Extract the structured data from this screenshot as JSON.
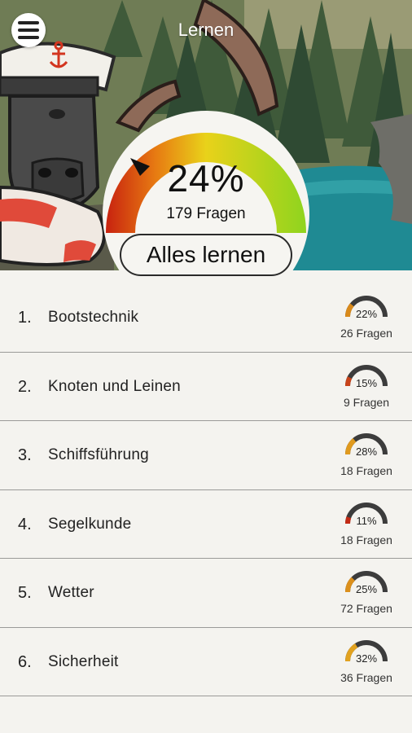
{
  "header": {
    "title": "Lernen",
    "menu_icon": "hamburger-menu-icon"
  },
  "overall": {
    "percent_label": "24%",
    "percent_value": 24,
    "questions_label": "179 Fragen",
    "button_label": "Alles lernen"
  },
  "colors": {
    "gauge_red": "#c8220f",
    "gauge_orange": "#e77b12",
    "gauge_yellow": "#e9d21a",
    "gauge_green": "#8fd41e",
    "mini_track": "#3c3c3c",
    "background": "#f4f3ef"
  },
  "categories": [
    {
      "num": "1.",
      "name": "Bootstechnik",
      "percent_label": "22%",
      "percent": 22,
      "questions": "26 Fragen",
      "color": "#d98a1b"
    },
    {
      "num": "2.",
      "name": "Knoten und Leinen",
      "percent_label": "15%",
      "percent": 15,
      "questions": "9 Fragen",
      "color": "#c8431a"
    },
    {
      "num": "3.",
      "name": "Schiffsführung",
      "percent_label": "28%",
      "percent": 28,
      "questions": "18 Fragen",
      "color": "#e09a1e"
    },
    {
      "num": "4.",
      "name": "Segelkunde",
      "percent_label": "11%",
      "percent": 11,
      "questions": "18 Fragen",
      "color": "#c32a14"
    },
    {
      "num": "5.",
      "name": "Wetter",
      "percent_label": "25%",
      "percent": 25,
      "questions": "72 Fragen",
      "color": "#dc901c"
    },
    {
      "num": "6.",
      "name": "Sicherheit",
      "percent_label": "32%",
      "percent": 32,
      "questions": "36 Fragen",
      "color": "#e2a21f"
    }
  ]
}
